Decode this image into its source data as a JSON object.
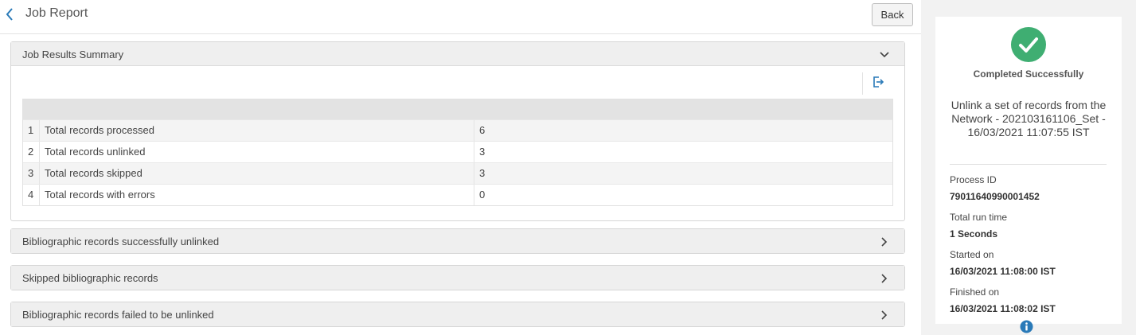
{
  "header": {
    "title": "Job Report",
    "back_label": "Back"
  },
  "summary": {
    "title": "Job Results Summary",
    "rows": [
      {
        "num": "1",
        "label": "Total records processed",
        "value": "6"
      },
      {
        "num": "2",
        "label": "Total records unlinked",
        "value": "3"
      },
      {
        "num": "3",
        "label": "Total records skipped",
        "value": "3"
      },
      {
        "num": "4",
        "label": "Total records with errors",
        "value": "0"
      }
    ]
  },
  "sections": [
    {
      "title": "Bibliographic records successfully unlinked"
    },
    {
      "title": "Skipped bibliographic records"
    },
    {
      "title": "Bibliographic records failed to be unlinked"
    }
  ],
  "side": {
    "status": "Completed Successfully",
    "job_name": "Unlink a set of records from the Network - 202103161106_Set - 16/03/2021 11:07:55 IST",
    "process_id_label": "Process ID",
    "process_id": "79011640990001452",
    "run_time_label": "Total run time",
    "run_time": "1 Seconds",
    "started_label": "Started on",
    "started": "16/03/2021 11:08:00 IST",
    "finished_label": "Finished on",
    "finished": "16/03/2021 11:08:02 IST"
  },
  "colors": {
    "accent": "#2a7ab8",
    "success": "#3fae72"
  },
  "icons": {
    "back": "chevron-left-icon",
    "export": "export-icon",
    "expand": "chevron-down-icon",
    "collapsed": "chevron-right-icon",
    "status": "check-circle-icon",
    "info": "info-icon"
  }
}
